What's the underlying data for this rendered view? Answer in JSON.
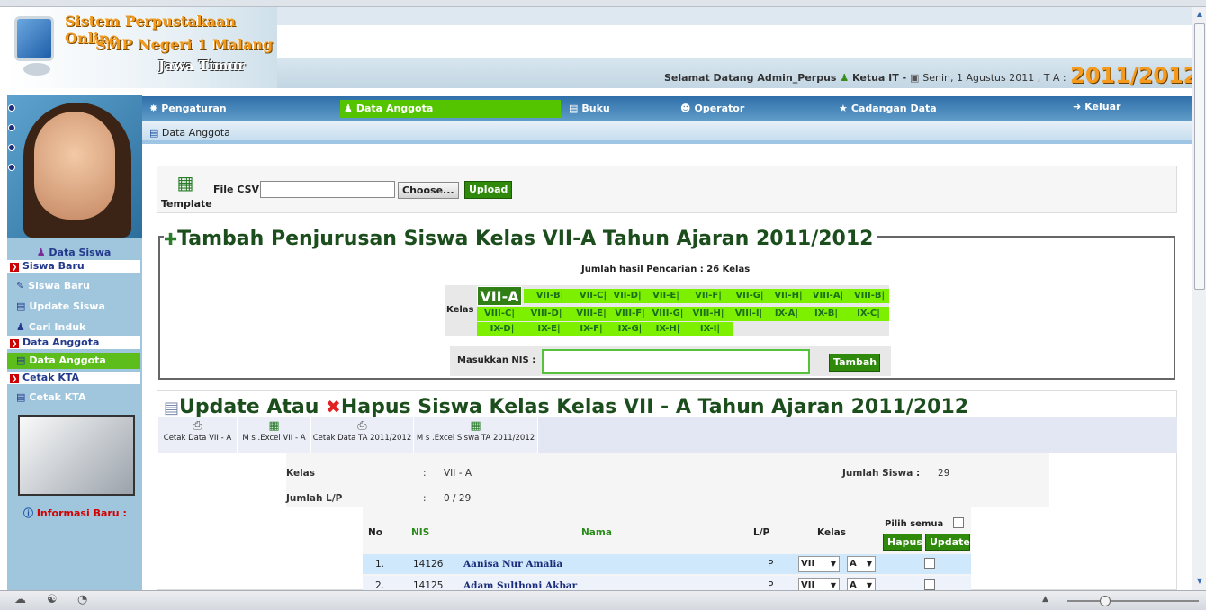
{
  "header": {
    "logo_line1": "Sistem Perpustakaan Online",
    "logo_line2": "SMP Negeri 1 Malang",
    "logo_line3": "Jawa Timur",
    "welcome": "Selamat Datang Admin_Perpus",
    "role": "Ketua IT -",
    "date": "Senin, 1 Agustus 2011 , T A :",
    "year": "2011/2012"
  },
  "nav": {
    "items": [
      {
        "label": "Pengaturan",
        "icon": "settings-icon"
      },
      {
        "label": "Data Anggota",
        "icon": "members-icon",
        "active": true
      },
      {
        "label": "Buku",
        "icon": "book-icon"
      },
      {
        "label": "Operator",
        "icon": "operator-icon"
      },
      {
        "label": "Cadangan Data",
        "icon": "backup-icon"
      },
      {
        "label": "Keluar",
        "icon": "logout-icon"
      }
    ]
  },
  "breadcrumb": "Data Anggota",
  "sidebar": {
    "title": "Data Siswa",
    "sections": [
      {
        "label": "Siswa Baru"
      },
      {
        "label": "Data Anggota"
      },
      {
        "label": "Cetak KTA"
      }
    ],
    "items": [
      {
        "label": "Siswa Baru"
      },
      {
        "label": "Update Siswa"
      },
      {
        "label": "Cari Induk"
      },
      {
        "label": "Data Anggota"
      },
      {
        "label": "Cetak KTA"
      }
    ],
    "info": "Informasi Baru :"
  },
  "upload": {
    "template_label": "Template",
    "file_label": "File CSV",
    "file_value": "",
    "choose_label": "Choose...",
    "upload_label": "Upload"
  },
  "add_section": {
    "title": "Tambah Penjurusan Siswa Kelas VII-A Tahun Ajaran 2011/2012",
    "result": "Jumlah hasil Pencarian : 26 Kelas",
    "kelas_label": "Kelas",
    "active_class": "VII-A",
    "row1": [
      "VII-B|",
      "VII-C|",
      "VII-D|",
      "VII-E|",
      "VII-F|",
      "VII-G|",
      "VII-H|",
      "VIII-A|",
      "VIII-B|"
    ],
    "row2": [
      "VIII-C|",
      "VIII-D|",
      "VIII-E|",
      "VIII-F|",
      "VIII-G|",
      "VIII-H|",
      "VIII-I|",
      "IX-A|",
      "IX-B|",
      "IX-C|"
    ],
    "row3": [
      "IX-D|",
      "IX-E|",
      "IX-F|",
      "IX-G|",
      "IX-H|",
      "IX-I|"
    ],
    "nis_label": "Masukkan NIS :",
    "nis_value": "",
    "add_button": "Tambah"
  },
  "update_section": {
    "title_part1": "Update Atau",
    "title_part2": "Hapus Siswa Kelas Kelas VII - A Tahun Ajaran 2011/2012",
    "toolbar": [
      {
        "label": "Cetak Data VII - A",
        "icon": "printer-icon"
      },
      {
        "label": "M s .Excel VII - A",
        "icon": "excel-icon"
      },
      {
        "label": "Cetak Data TA 2011/2012",
        "icon": "printer-icon"
      },
      {
        "label": "M s .Excel  Siswa TA 2011/2012",
        "icon": "excel-icon"
      }
    ],
    "info": {
      "kelas_label": "Kelas",
      "kelas_value": "VII - A",
      "jumlah_siswa_label": "Jumlah Siswa :",
      "jumlah_siswa_value": "29",
      "jumlah_lp_label": "Jumlah L/P",
      "jumlah_lp_value": "0 / 29",
      "sep": ":"
    },
    "table": {
      "headers": {
        "no": "No",
        "nis": "NIS",
        "nama": "Nama",
        "lp": "L/P",
        "kelas": "Kelas",
        "pilih": "Pilih semua"
      },
      "hapus_label": "Hapus",
      "update_label": "Update",
      "rows": [
        {
          "no": "1.",
          "nis": "14126",
          "nama": "Aanisa Nur Amalia",
          "lp": "P",
          "kelas": "VII",
          "sub": "A"
        },
        {
          "no": "2.",
          "nis": "14125",
          "nama": "Adam Sulthoni Akbar",
          "lp": "P",
          "kelas": "VII",
          "sub": "A"
        }
      ]
    }
  }
}
